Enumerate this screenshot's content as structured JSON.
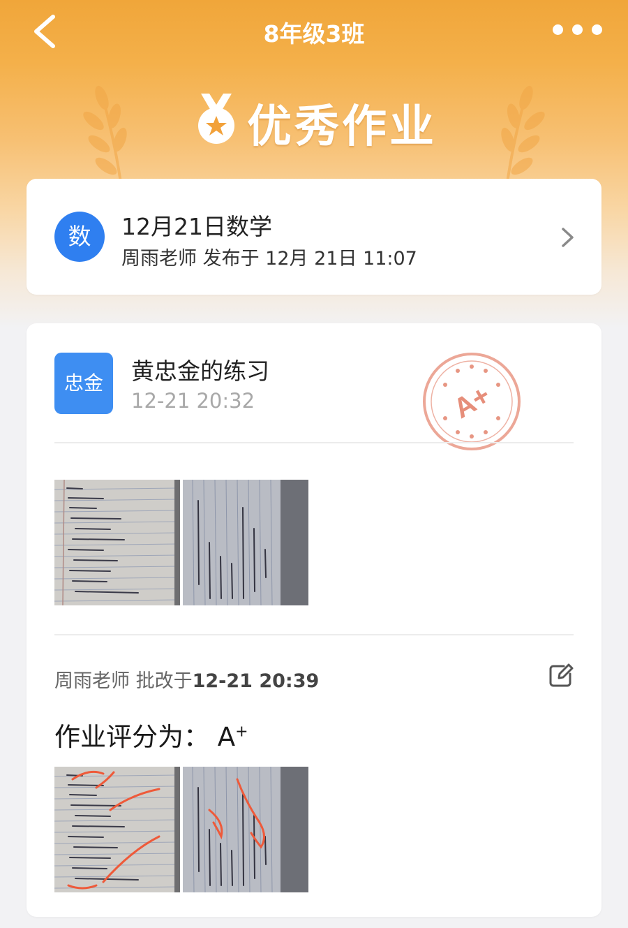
{
  "nav": {
    "title": "8年级3班"
  },
  "banner": {
    "title": "优秀作业"
  },
  "assignment": {
    "subject_badge": "数",
    "title": "12月21日数学",
    "meta": "周雨老师 发布于 12月 21日 11:07"
  },
  "submission": {
    "student_badge": "忠金",
    "title": "黄忠金的练习",
    "time": "12-21 20:32",
    "stamp_grade": "A+"
  },
  "review": {
    "teacher": "周雨老师",
    "action": "批改于",
    "time": "12-21 20:39",
    "grade_label": "作业评分为：",
    "grade_letter": "A",
    "grade_modifier": "+"
  },
  "colors": {
    "header_orange": "#f0a63a",
    "subject_blue": "#2f7ff0",
    "student_blue": "#3e8ef2",
    "stamp_red": "#e0735a",
    "annotation_red": "#ee5a3a"
  },
  "icons": {
    "back": "chevron-left-icon",
    "more": "more-dots-icon",
    "medal": "medal-star-icon",
    "next": "chevron-right-icon",
    "edit": "edit-icon"
  }
}
